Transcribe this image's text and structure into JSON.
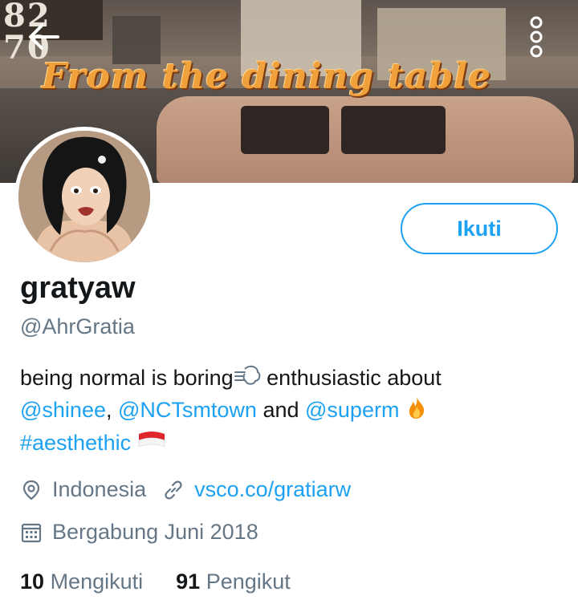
{
  "banner": {
    "sign_text": "82 70",
    "title": "From the dining table"
  },
  "header": {
    "back_icon": "arrow-left-icon",
    "more_icon": "more-vertical-icon"
  },
  "profile": {
    "follow_label": "Ikuti",
    "display_name": "gratyaw",
    "handle": "@AhrGratia",
    "bio": {
      "part1": "being normal is boring",
      "part2": " enthusiastic about",
      "mention1": "@shinee",
      "comma": ", ",
      "mention2": "@NCTsmtown",
      "and": " and ",
      "mention3": "@superm",
      "hashtag": "#aesthethic"
    },
    "location": "Indonesia",
    "website": "vsco.co/gratiarw",
    "joined": "Bergabung Juni 2018",
    "following_count": "10",
    "following_label": "Mengikuti",
    "followers_count": "91",
    "followers_label": "Pengikut"
  },
  "colors": {
    "accent": "#1da1f2",
    "muted": "#657786",
    "text": "#14171a"
  }
}
